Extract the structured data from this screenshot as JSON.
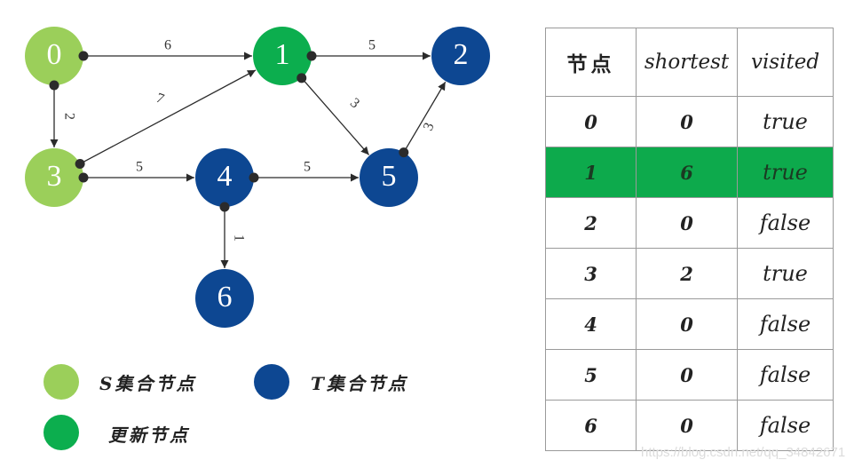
{
  "graph": {
    "nodes": [
      {
        "id": "0",
        "label": "0",
        "set": "S"
      },
      {
        "id": "1",
        "label": "1",
        "set": "updated"
      },
      {
        "id": "2",
        "label": "2",
        "set": "T"
      },
      {
        "id": "3",
        "label": "3",
        "set": "S"
      },
      {
        "id": "4",
        "label": "4",
        "set": "T"
      },
      {
        "id": "5",
        "label": "5",
        "set": "T"
      },
      {
        "id": "6",
        "label": "6",
        "set": "T"
      }
    ],
    "edges": [
      {
        "from": "0",
        "to": "1",
        "weight": "6"
      },
      {
        "from": "0",
        "to": "3",
        "weight": "2"
      },
      {
        "from": "1",
        "to": "2",
        "weight": "5"
      },
      {
        "from": "1",
        "to": "5",
        "weight": "3"
      },
      {
        "from": "3",
        "to": "1",
        "weight": "7"
      },
      {
        "from": "3",
        "to": "4",
        "weight": "5"
      },
      {
        "from": "4",
        "to": "5",
        "weight": "5"
      },
      {
        "from": "4",
        "to": "6",
        "weight": "1"
      },
      {
        "from": "5",
        "to": "2",
        "weight": "3"
      }
    ],
    "colors": {
      "S": "#9bcf5a",
      "updated": "#0cae4e",
      "T": "#0d4792",
      "edge": "#2b2b2b"
    }
  },
  "legend": [
    {
      "set": "S",
      "label": "S集合节点"
    },
    {
      "set": "T",
      "label": "T集合节点"
    },
    {
      "set": "updated",
      "label": "更新节点"
    }
  ],
  "table": {
    "headers": [
      "节点",
      "shortest",
      "visited"
    ],
    "highlight_color": "#0daa4c",
    "rows": [
      {
        "node": "0",
        "shortest": "0",
        "visited": "true",
        "highlight": false
      },
      {
        "node": "1",
        "shortest": "6",
        "visited": "true",
        "highlight": true
      },
      {
        "node": "2",
        "shortest": "0",
        "visited": "false",
        "highlight": false
      },
      {
        "node": "3",
        "shortest": "2",
        "visited": "true",
        "highlight": false
      },
      {
        "node": "4",
        "shortest": "0",
        "visited": "false",
        "highlight": false
      },
      {
        "node": "5",
        "shortest": "0",
        "visited": "false",
        "highlight": false
      },
      {
        "node": "6",
        "shortest": "0",
        "visited": "false",
        "highlight": false
      }
    ]
  },
  "watermark": "https://blog.csdn.net/qq_34842671"
}
